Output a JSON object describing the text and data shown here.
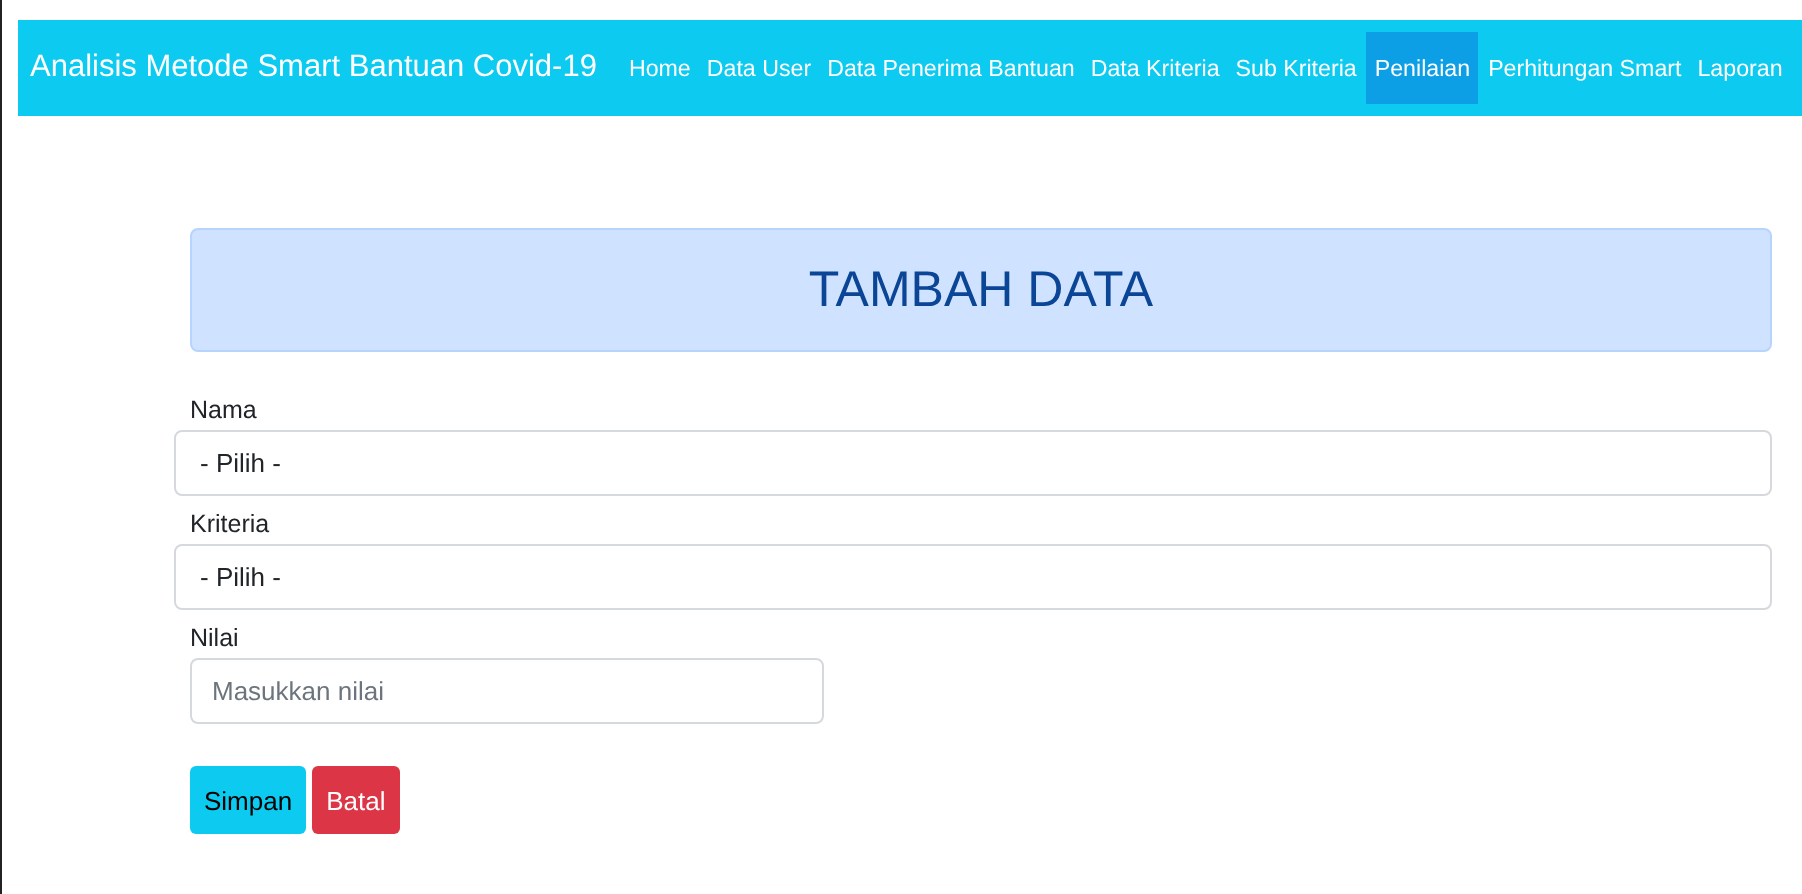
{
  "navbar": {
    "brand": "Analisis Metode Smart Bantuan Covid-19",
    "items": [
      {
        "label": "Home",
        "selected": false
      },
      {
        "label": "Data User",
        "selected": false
      },
      {
        "label": "Data Penerima Bantuan",
        "selected": false
      },
      {
        "label": "Data Kriteria",
        "selected": false
      },
      {
        "label": "Sub Kriteria",
        "selected": false
      },
      {
        "label": "Penilaian",
        "selected": true
      },
      {
        "label": "Perhitungan Smart",
        "selected": false
      },
      {
        "label": "Laporan",
        "selected": false
      }
    ]
  },
  "header": {
    "title": "TAMBAH DATA"
  },
  "fields": [
    {
      "kind": "select",
      "label": "Nama",
      "value": "- Pilih -"
    },
    {
      "kind": "select",
      "label": "Kriteria",
      "value": "- Pilih -"
    },
    {
      "kind": "input",
      "label": "Nilai",
      "placeholder": "Masukkan nilai"
    }
  ],
  "buttons": [
    {
      "kind": "primary",
      "label": "Simpan"
    },
    {
      "kind": "danger",
      "label": "Batal"
    }
  ]
}
